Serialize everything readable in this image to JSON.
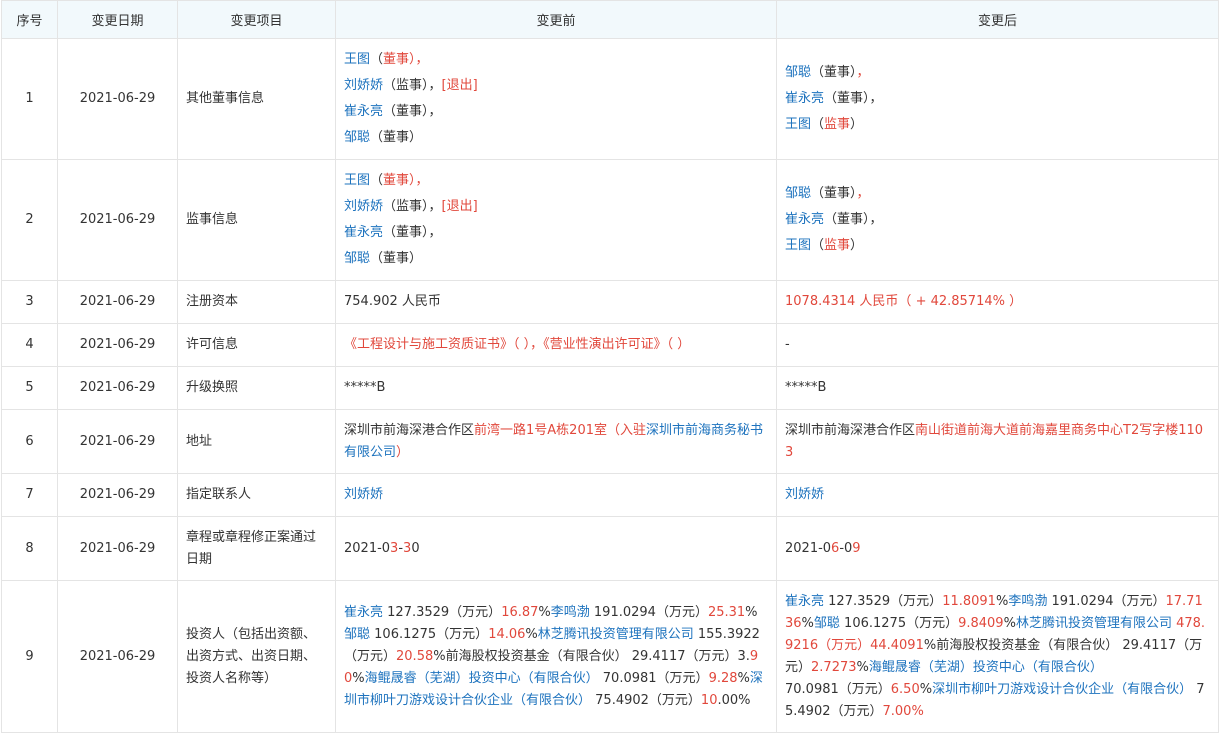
{
  "headers": {
    "seq": "序号",
    "date": "变更日期",
    "item": "变更项目",
    "before": "变更前",
    "after": "变更后"
  },
  "rows": [
    {
      "seq": "1",
      "date": "2021-06-29",
      "item": "其他董事信息",
      "before": [
        [
          [
            "王图",
            "b"
          ],
          [
            "（",
            "k"
          ],
          [
            "董事",
            "r"
          ],
          [
            "），",
            "r"
          ]
        ],
        [
          [
            "刘娇娇",
            "b"
          ],
          [
            "（监事），",
            "k"
          ],
          [
            "[退出]",
            "r"
          ]
        ],
        [
          [
            "崔永亮",
            "b"
          ],
          [
            "（董事），",
            "k"
          ]
        ],
        [
          [
            "邹聪",
            "b"
          ],
          [
            "（董事）",
            "k"
          ]
        ]
      ],
      "after": [
        [
          [
            "邹聪",
            "b"
          ],
          [
            "（董事）",
            "k"
          ],
          [
            "，",
            "r"
          ]
        ],
        [
          [
            "崔永亮",
            "b"
          ],
          [
            "（董事），",
            "k"
          ]
        ],
        [
          [
            "王图",
            "b"
          ],
          [
            "（",
            "k"
          ],
          [
            "监事",
            "r"
          ],
          [
            "）",
            "k"
          ]
        ]
      ]
    },
    {
      "seq": "2",
      "date": "2021-06-29",
      "item": "监事信息",
      "before": [
        [
          [
            "王图",
            "b"
          ],
          [
            "（",
            "k"
          ],
          [
            "董事",
            "r"
          ],
          [
            "），",
            "r"
          ]
        ],
        [
          [
            "刘娇娇",
            "b"
          ],
          [
            "（监事），",
            "k"
          ],
          [
            "[退出]",
            "r"
          ]
        ],
        [
          [
            "崔永亮",
            "b"
          ],
          [
            "（董事），",
            "k"
          ]
        ],
        [
          [
            "邹聪",
            "b"
          ],
          [
            "（董事）",
            "k"
          ]
        ]
      ],
      "after": [
        [
          [
            "邹聪",
            "b"
          ],
          [
            "（董事）",
            "k"
          ],
          [
            "，",
            "r"
          ]
        ],
        [
          [
            "崔永亮",
            "b"
          ],
          [
            "（董事），",
            "k"
          ]
        ],
        [
          [
            "王图",
            "b"
          ],
          [
            "（",
            "k"
          ],
          [
            "监事",
            "r"
          ],
          [
            "）",
            "k"
          ]
        ]
      ]
    },
    {
      "seq": "3",
      "date": "2021-06-29",
      "item": "注册资本",
      "before": [
        [
          [
            "754.902 人民币",
            "k"
          ]
        ]
      ],
      "after": [
        [
          [
            "1078.4314 人民币（ + 42.85714% ）",
            "r"
          ]
        ]
      ]
    },
    {
      "seq": "4",
      "date": "2021-06-29",
      "item": "许可信息",
      "before": [
        [
          [
            "《工程设计与施工资质证书》（ ），《营业性演出许可证》（ ）",
            "r"
          ]
        ]
      ],
      "after": [
        [
          [
            "-",
            "k"
          ]
        ]
      ]
    },
    {
      "seq": "5",
      "date": "2021-06-29",
      "item": "升级换照",
      "before": [
        [
          [
            "*****B",
            "k"
          ]
        ]
      ],
      "after": [
        [
          [
            "*****B",
            "k"
          ]
        ]
      ]
    },
    {
      "seq": "6",
      "date": "2021-06-29",
      "item": "地址",
      "before": [
        [
          [
            "深圳市前海深港合作区",
            "k"
          ],
          [
            "前湾一路1号A栋201室（入驻",
            "r"
          ],
          [
            "深圳市前海商务秘书有限公司",
            "b"
          ],
          [
            "）",
            "r"
          ]
        ]
      ],
      "after": [
        [
          [
            "深圳市前海深港合作区",
            "k"
          ],
          [
            "南山街道前海大道前海嘉里商务中心T2写字楼1103",
            "r"
          ]
        ]
      ]
    },
    {
      "seq": "7",
      "date": "2021-06-29",
      "item": "指定联系人",
      "before": [
        [
          [
            "刘娇娇",
            "b"
          ]
        ]
      ],
      "after": [
        [
          [
            "刘娇娇",
            "b"
          ]
        ]
      ]
    },
    {
      "seq": "8",
      "date": "2021-06-29",
      "item": "章程或章程修正案通过日期",
      "before": [
        [
          [
            "2021-0",
            "k"
          ],
          [
            "3",
            "r"
          ],
          [
            "-",
            "k"
          ],
          [
            "3",
            "r"
          ],
          [
            "0",
            "k"
          ]
        ]
      ],
      "after": [
        [
          [
            "2021-0",
            "k"
          ],
          [
            "6",
            "r"
          ],
          [
            "-0",
            "k"
          ],
          [
            "9",
            "r"
          ]
        ]
      ]
    },
    {
      "seq": "9",
      "date": "2021-06-29",
      "item": "投资人（包括出资额、出资方式、出资日期、投资人名称等）",
      "before": [
        [
          [
            "崔永亮",
            "b"
          ],
          [
            " 127.3529（万元）",
            "k"
          ],
          [
            "16.87",
            "r"
          ],
          [
            "%",
            "k"
          ],
          [
            "李鸣渤",
            "b"
          ],
          [
            " 191.0294（万元）",
            "k"
          ],
          [
            "25.31",
            "r"
          ],
          [
            "%",
            "k"
          ],
          [
            "邹聪",
            "b"
          ],
          [
            " 106.1275（万元）",
            "k"
          ],
          [
            "14.06",
            "r"
          ],
          [
            "%",
            "k"
          ],
          [
            "林芝腾讯投资管理有限公司",
            "b"
          ],
          [
            " 155.3922（万元）",
            "k"
          ],
          [
            "20.58",
            "r"
          ],
          [
            "%",
            "k"
          ],
          [
            "前海股权投资基金（有限合伙）",
            "k"
          ],
          [
            " 29.4117（万元）3.",
            "k"
          ],
          [
            "90",
            "r"
          ],
          [
            "%",
            "k"
          ],
          [
            "海鲲晟睿（芜湖）投资中心（有限合伙）",
            "b"
          ],
          [
            " 70.0981（万元）",
            "k"
          ],
          [
            "9.28",
            "r"
          ],
          [
            "%",
            "k"
          ],
          [
            "深圳市柳叶刀游戏设计合伙企业（有限合伙）",
            "b"
          ],
          [
            " 75.4902（万元）",
            "k"
          ],
          [
            "10",
            "r"
          ],
          [
            ".00%",
            "k"
          ]
        ]
      ],
      "after": [
        [
          [
            "崔永亮",
            "b"
          ],
          [
            " 127.3529（万元）",
            "k"
          ],
          [
            "11.8091",
            "r"
          ],
          [
            "%",
            "k"
          ],
          [
            "李鸣渤",
            "b"
          ],
          [
            " 191.0294（万元）",
            "k"
          ],
          [
            "17.7136",
            "r"
          ],
          [
            "%",
            "k"
          ],
          [
            "邹聪",
            "b"
          ],
          [
            " 106.1275（万元）",
            "k"
          ],
          [
            "9.8409",
            "r"
          ],
          [
            "%",
            "k"
          ],
          [
            "林芝腾讯投资管理有限公司",
            "b"
          ],
          [
            " 478.9216（万元）",
            "r"
          ],
          [
            "44.4091",
            "r"
          ],
          [
            "%",
            "k"
          ],
          [
            "前海股权投资基金（有限合伙）",
            "k"
          ],
          [
            " 29.4117（万元）",
            "k"
          ],
          [
            "2.7273",
            "r"
          ],
          [
            "%",
            "k"
          ],
          [
            "海鲲晟睿（芜湖）投资中心（有限合伙）",
            "b"
          ],
          [
            " 70.0981（万元）",
            "k"
          ],
          [
            "6.50",
            "r"
          ],
          [
            "%",
            "k"
          ],
          [
            "深圳市柳叶刀游戏设计合伙企业（有限合伙）",
            "b"
          ],
          [
            " 75.4902（万元）",
            "k"
          ],
          [
            "7.00%",
            "r"
          ]
        ]
      ]
    }
  ]
}
